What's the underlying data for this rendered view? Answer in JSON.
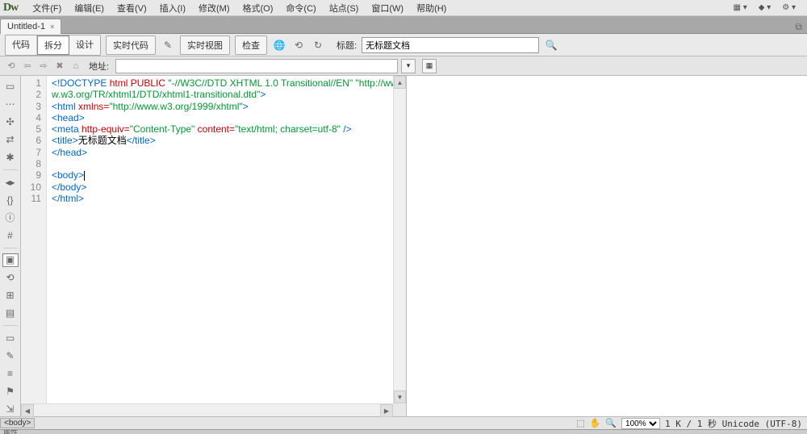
{
  "app": {
    "logo": "Dw"
  },
  "menu": {
    "items": [
      "文件(F)",
      "编辑(E)",
      "查看(V)",
      "插入(I)",
      "修改(M)",
      "格式(O)",
      "命令(C)",
      "站点(S)",
      "窗口(W)",
      "帮助(H)"
    ],
    "extra": [
      "▦ ▾",
      "◆ ▾",
      "⚙ ▾"
    ]
  },
  "doctab": {
    "title": "Untitled-1",
    "close": "×",
    "menu_icon": "⧉"
  },
  "viewbar": {
    "modes": [
      "代码",
      "拆分",
      "设计"
    ],
    "active_mode": 1,
    "live_code": "实时代码",
    "live_view": "实时视图",
    "inspect": "检查",
    "icons": [
      "✎",
      "🌐",
      "⟲",
      "↻"
    ],
    "title_label": "标题:",
    "title_value": "无标题文档",
    "search_icon": "🔍"
  },
  "addrbar": {
    "nav_icons": [
      "⟲",
      "⇦",
      "⇨",
      "✖",
      "⌂"
    ],
    "label": "地址:",
    "value": "",
    "dropdown": "▾",
    "table_icon": "▦"
  },
  "left_tools": {
    "top": [
      "▭",
      "⋯",
      "✣",
      "⇄",
      "✱",
      "",
      "◂▸",
      "{}",
      "ⓘ",
      "#"
    ],
    "mid_selected": "▣",
    "mid": [
      "⟲",
      "⊞",
      "▤"
    ],
    "bottom": [
      "▭",
      "✎",
      "≡",
      "⚑",
      "⇲"
    ]
  },
  "code": {
    "lines": [
      {
        "n": "1",
        "html": "<span class='kw'>&lt;!DOCTYPE</span> <span class='attr'>html PUBLIC</span> <span class='str'>\"-//W3C//DTD XHTML 1.0 Transitional//EN\"</span> <span class='str'>\"http://www.w3.org/TR/xhtml1/DTD/xhtml1-transitional.dtd\"</span><span class='kw'>&gt;</span>"
      },
      {
        "n": "2",
        "html": "<span class='kw'>&lt;html</span> <span class='attr'>xmlns=</span><span class='str'>\"http://www.w3.org/1999/xhtml\"</span><span class='kw'>&gt;</span>"
      },
      {
        "n": "3",
        "html": "<span class='kw'>&lt;head&gt;</span>"
      },
      {
        "n": "4",
        "html": "<span class='kw'>&lt;meta</span> <span class='attr'>http-equiv=</span><span class='str'>\"Content-Type\"</span> <span class='attr'>content=</span><span class='str'>\"text/html; charset=utf-8\"</span> <span class='kw'>/&gt;</span>"
      },
      {
        "n": "5",
        "html": "<span class='kw'>&lt;title&gt;</span><span class='txt'>无标题文档</span><span class='kw'>&lt;/title&gt;</span>"
      },
      {
        "n": "6",
        "html": "<span class='kw'>&lt;/head&gt;</span>"
      },
      {
        "n": "7",
        "html": ""
      },
      {
        "n": "8",
        "html": "<span class='kw'>&lt;body&gt;</span><span class='cursor-caret'></span>"
      },
      {
        "n": "9",
        "html": "<span class='kw'>&lt;/body&gt;</span>"
      },
      {
        "n": "10",
        "html": "<span class='kw'>&lt;/html&gt;</span>"
      },
      {
        "n": "11",
        "html": ""
      }
    ]
  },
  "tagbar": {
    "path": "<body>",
    "tools": [
      "⬚",
      "✋",
      "🔍"
    ],
    "zoom": "100%",
    "status": "1 K / 1 秒 Unicode (UTF-8)"
  },
  "propbar": {
    "label": "属性"
  }
}
